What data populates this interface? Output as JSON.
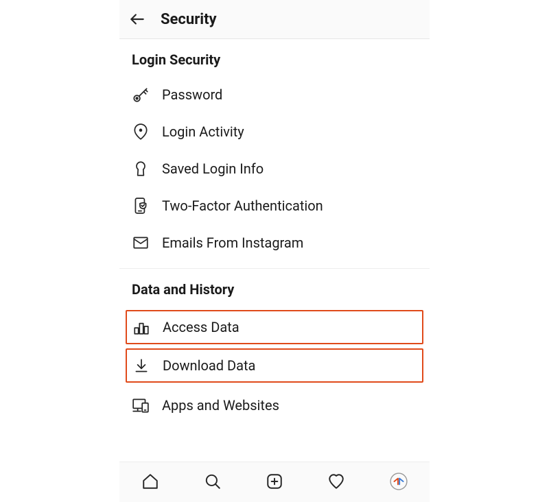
{
  "header": {
    "title": "Security"
  },
  "section1": {
    "title": "Login Security",
    "items": {
      "password": "Password",
      "login_activity": "Login Activity",
      "saved_login_info": "Saved Login Info",
      "two_factor": "Two-Factor Authentication",
      "emails": "Emails From Instagram"
    }
  },
  "section2": {
    "title": "Data and History",
    "items": {
      "access_data": "Access Data",
      "download_data": "Download Data",
      "apps_websites": "Apps and Websites"
    }
  }
}
